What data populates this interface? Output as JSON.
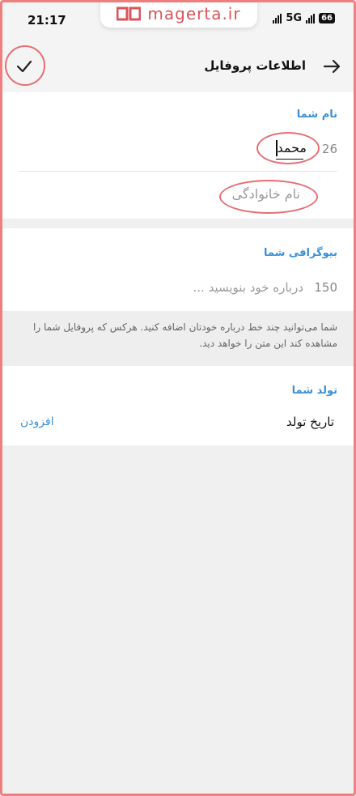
{
  "status_bar": {
    "time": "21:17",
    "network": "5G",
    "battery": "66"
  },
  "watermark": {
    "text": "magerta.ir"
  },
  "app_bar": {
    "title": "اطلاعات پروفایل"
  },
  "name_section": {
    "title": "نام شما",
    "first_name_value": "محمد",
    "first_name_counter": "26",
    "last_name_placeholder": "نام خانوادگی"
  },
  "bio_section": {
    "title": "بیوگرافی شما",
    "placeholder": "درباره خود بنویسید ...",
    "counter": "150",
    "hint": "شما می‌توانید چند خط درباره خودتان اضافه کنید. هرکس که پروفایل شما را مشاهده کند این متن را خواهد دید."
  },
  "birthday_section": {
    "title": "تولد شما",
    "label": "تاریخ تولد",
    "add_label": "افزودن"
  },
  "colors": {
    "accent": "#3a8fd6",
    "highlight_ring": "#e66e75",
    "background": "#f0f0f0"
  }
}
